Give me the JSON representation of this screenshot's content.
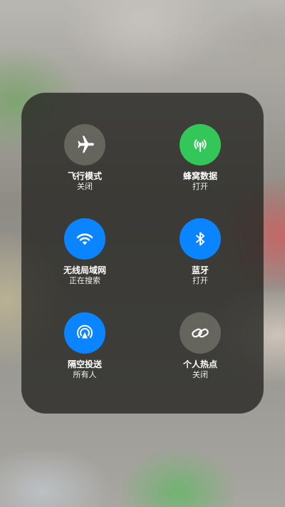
{
  "control_center": {
    "tiles": [
      {
        "label": "飞行模式",
        "status": "关闭",
        "icon": "airplane-icon",
        "state": "off",
        "color": "#8a8a7c"
      },
      {
        "label": "蜂窝数据",
        "status": "打开",
        "icon": "cellular-antenna-icon",
        "state": "on",
        "color": "#33c759"
      },
      {
        "label": "无线局域网",
        "status": "正在搜索",
        "icon": "wifi-icon",
        "state": "on",
        "color": "#0a84ff"
      },
      {
        "label": "蓝牙",
        "status": "打开",
        "icon": "bluetooth-icon",
        "state": "on",
        "color": "#0a84ff"
      },
      {
        "label": "隔空投送",
        "status": "所有人",
        "icon": "airdrop-icon",
        "state": "on",
        "color": "#0a84ff"
      },
      {
        "label": "个人热点",
        "status": "关闭",
        "icon": "personal-hotspot-icon",
        "state": "off",
        "color": "#8a8a7c"
      }
    ]
  }
}
